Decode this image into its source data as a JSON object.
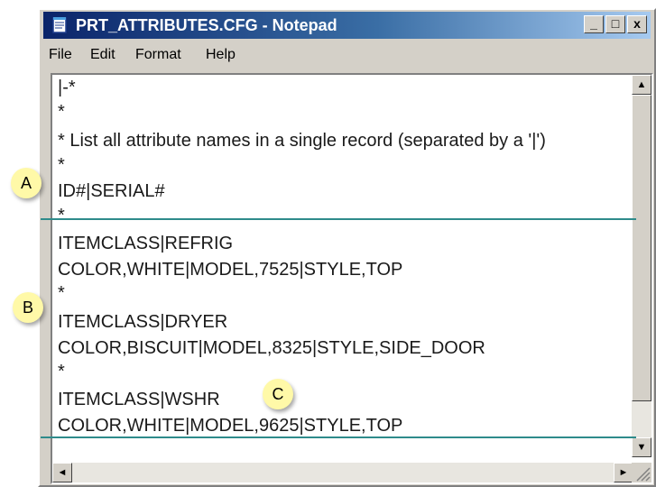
{
  "window": {
    "title": "PRT_ATTRIBUTES.CFG - Notepad",
    "controls": {
      "minimize": "_",
      "maximize": "□",
      "close": "x"
    }
  },
  "menu": [
    "File",
    "Edit",
    "Format",
    "Help"
  ],
  "editor": {
    "lines": [
      "|-*",
      "*",
      "* List all attribute names in a single record (separated by a '|')",
      "*",
      "ID#|SERIAL#",
      "*",
      "ITEMCLASS|REFRIG",
      "COLOR,WHITE|MODEL,7525|STYLE,TOP",
      "*",
      "ITEMCLASS|DRYER",
      "COLOR,BISCUIT|MODEL,8325|STYLE,SIDE_DOOR",
      "*",
      "ITEMCLASS|WSHR",
      "COLOR,WHITE|MODEL,9625|STYLE,TOP"
    ]
  },
  "scrollbar": {
    "up": "▲",
    "down": "▼",
    "left": "◄",
    "right": "►"
  },
  "callouts": {
    "a": "A",
    "b": "B",
    "c": "C"
  },
  "colors": {
    "divider": "#2e8b8b",
    "callout": "#fff9a8",
    "titlebar": "#0a246a"
  },
  "icons": {
    "app": "notepad-icon"
  }
}
